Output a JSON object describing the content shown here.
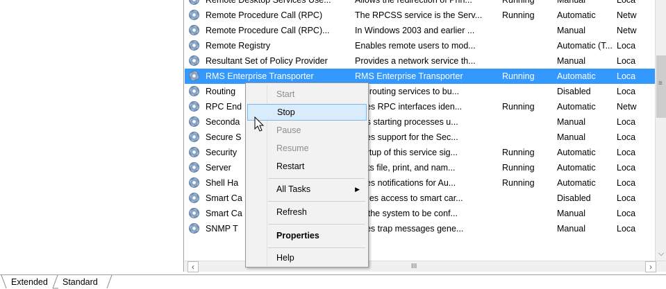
{
  "rows": [
    {
      "name": "Remote Desktop Services Use...",
      "desc": "Allows the redirection of Prin...",
      "status": "Running",
      "startup": "Manual",
      "logon": "Loca",
      "partial": true
    },
    {
      "name": "Remote Procedure Call (RPC)",
      "desc": "The RPCSS service is the Serv...",
      "status": "Running",
      "startup": "Automatic",
      "logon": "Netw"
    },
    {
      "name": "Remote Procedure Call (RPC)...",
      "desc": "In Windows 2003 and earlier ...",
      "status": "",
      "startup": "Manual",
      "logon": "Netw"
    },
    {
      "name": "Remote Registry",
      "desc": "Enables remote users to mod...",
      "status": "",
      "startup": "Automatic (T...",
      "logon": "Loca"
    },
    {
      "name": "Resultant Set of Policy Provider",
      "desc": "Provides a network service th...",
      "status": "",
      "startup": "Manual",
      "logon": "Loca"
    },
    {
      "name": "RMS Enterprise Transporter",
      "desc": "RMS Enterprise Transporter",
      "status": "Running",
      "startup": "Automatic",
      "logon": "Loca",
      "selected": true
    },
    {
      "name": "Routing",
      "desc": "ers routing services to bu...",
      "status": "",
      "startup": "Disabled",
      "logon": "Loca"
    },
    {
      "name": "RPC End",
      "desc": "olves RPC interfaces iden...",
      "status": "Running",
      "startup": "Automatic",
      "logon": "Netw"
    },
    {
      "name": "Seconda",
      "desc": "bles starting processes u...",
      "status": "",
      "startup": "Manual",
      "logon": "Loca"
    },
    {
      "name": "Secure S",
      "desc": "vides support for the Sec...",
      "status": "",
      "startup": "Manual",
      "logon": "Loca"
    },
    {
      "name": "Security",
      "desc": "startup of this service sig...",
      "status": "Running",
      "startup": "Automatic",
      "logon": "Loca"
    },
    {
      "name": "Server",
      "desc": "ports file, print, and nam...",
      "status": "Running",
      "startup": "Automatic",
      "logon": "Loca"
    },
    {
      "name": "Shell Ha",
      "desc": "vides notifications for Au...",
      "status": "Running",
      "startup": "Automatic",
      "logon": "Loca"
    },
    {
      "name": "Smart Ca",
      "desc": "nages access to smart car...",
      "status": "",
      "startup": "Disabled",
      "logon": "Loca"
    },
    {
      "name": "Smart Ca",
      "desc": "ws the system to be conf...",
      "status": "",
      "startup": "Manual",
      "logon": "Loca"
    },
    {
      "name": "SNMP T",
      "desc": "eives trap messages gene...",
      "status": "",
      "startup": "Manual",
      "logon": "Loca"
    }
  ],
  "context_menu": {
    "start": "Start",
    "stop": "Stop",
    "pause": "Pause",
    "resume": "Resume",
    "restart": "Restart",
    "all_tasks": "All Tasks",
    "refresh": "Refresh",
    "properties": "Properties",
    "help": "Help"
  },
  "tabs": {
    "extended": "Extended",
    "standard": "Standard"
  },
  "icons": {
    "service": "service-gear-icon",
    "submenu": "triangle-right-icon",
    "scroll_left": "chevron-left-icon",
    "scroll_right": "chevron-right-icon",
    "scroll_down": "chevron-down-icon",
    "grip": "scroll-grip-icon",
    "cursor": "mouse-pointer-icon"
  },
  "colors": {
    "selection": "#3399ff",
    "menu_highlight": "#d9ecfb",
    "menu_highlight_border": "#79b6ef",
    "disabled_text": "#8d8d8d"
  }
}
